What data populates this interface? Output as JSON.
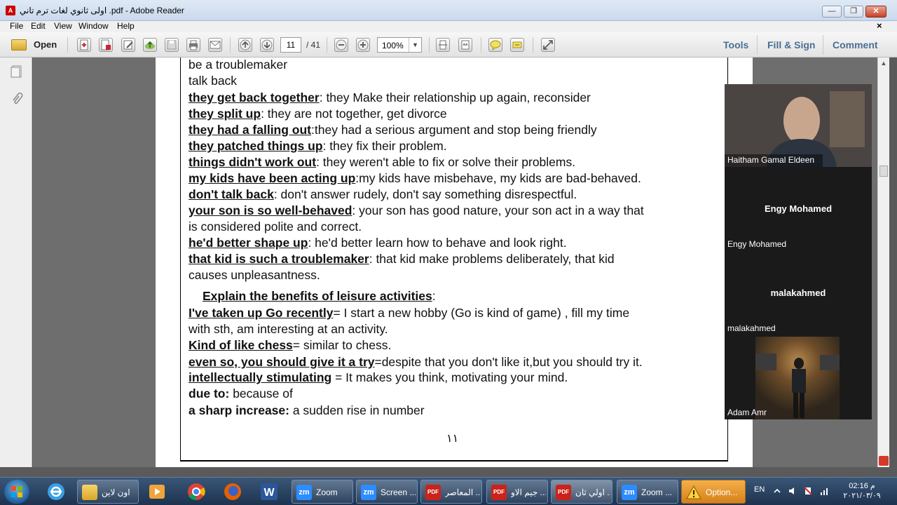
{
  "window": {
    "title": "اولى ثانوي لغات ترم تاني .pdf - Adobe Reader",
    "minimize_label": "—",
    "maximize_label": "❐",
    "close_label": "✕"
  },
  "menu": {
    "items": [
      "File",
      "Edit",
      "View",
      "Window",
      "Help"
    ],
    "doc_close": "×"
  },
  "toolbar": {
    "open_label": "Open",
    "page_current": "11",
    "page_total": "/ 41",
    "zoom_value": "100%",
    "zoom_arrow": "▼",
    "links": [
      "Tools",
      "Fill & Sign",
      "Comment"
    ]
  },
  "document": {
    "lines": [
      {
        "bold": "",
        "text": "be a troublemaker"
      },
      {
        "bold": "",
        "text": "talk back"
      },
      {
        "bold": "they get back together",
        "text": ": they Make their relationship up again, reconsider"
      },
      {
        "bold": "they split up",
        "text": ": they are not together, get divorce"
      },
      {
        "bold": "they had a falling out",
        "text": ":they had a serious argument and stop being friendly"
      },
      {
        "bold": "they patched things up",
        "text": ": they fix their problem."
      },
      {
        "bold": "things didn't work out",
        "text": ": they weren't able to fix or solve their problems."
      },
      {
        "bold": "my kids have been acting up",
        "text": ":my kids have misbehave, my kids are bad-behaved."
      },
      {
        "bold": "don't talk back",
        "text": ": don't answer rudely, don't say something disrespectful."
      },
      {
        "bold": "your son is so well-behaved",
        "text": ": your son has good nature, your son act in a way that"
      },
      {
        "bold": "",
        "text": "is considered polite and correct."
      },
      {
        "bold": "he'd better shape up",
        "text": ": he'd better learn how to behave and look right."
      },
      {
        "bold": "that kid is such a troublemaker",
        "text": ": that kid  make problems deliberately, that kid"
      },
      {
        "bold": "",
        "text": "causes unpleasantness."
      },
      {
        "bold": "Explain the benefits of leisure activities",
        "text": ":"
      },
      {
        "bold": "I've taken up Go recently",
        "text": "= I start a new hobby (Go is kind of game) , fill my time"
      },
      {
        "bold": "",
        "text": "with sth, am interesting at an activity."
      },
      {
        "bold": "Kind of like chess",
        "text": "= similar to chess."
      },
      {
        "bold": "even so, you should give it a try",
        "text": "=despite that you don't like it,but you should try it."
      },
      {
        "bold": "intellectually stimulating",
        "text": " = It makes you think, motivating your mind."
      },
      {
        "bold": "due to:",
        "text": " because of"
      },
      {
        "bold": "a sharp increase:",
        "text": " a sudden rise in number"
      }
    ],
    "page_number": "١١"
  },
  "zoom": {
    "participants": [
      {
        "name": "Haitham Gamal Eldeen",
        "center": ""
      },
      {
        "name": "Engy Mohamed",
        "center": "Engy Mohamed"
      },
      {
        "name": "malakahmed",
        "center": "malakahmed"
      },
      {
        "name": "Adam Amr",
        "center": ""
      }
    ]
  },
  "taskbar": {
    "buttons": [
      {
        "label": "اون لاين",
        "kind": "folder"
      },
      {
        "label": "Zoom",
        "kind": "zoom"
      },
      {
        "label": "Screen ...",
        "kind": "zoom"
      },
      {
        "label": "المعاصر ...",
        "kind": "pdf"
      },
      {
        "label": "جيم الاو ...",
        "kind": "pdf"
      },
      {
        "label": "اولي ثان ...",
        "kind": "pdf"
      },
      {
        "label": "Zoom ...",
        "kind": "zoom"
      },
      {
        "label": "Option...",
        "kind": "warning"
      }
    ],
    "lang": "EN",
    "time": "02:16 م",
    "date": "٢٠٢١/٠٣/٠٩"
  },
  "colors": {
    "accent_link": "#4a6e94",
    "taskbar": "#1d3350",
    "zoom_blue": "#2d8cff",
    "pdf_red": "#c8241b"
  }
}
